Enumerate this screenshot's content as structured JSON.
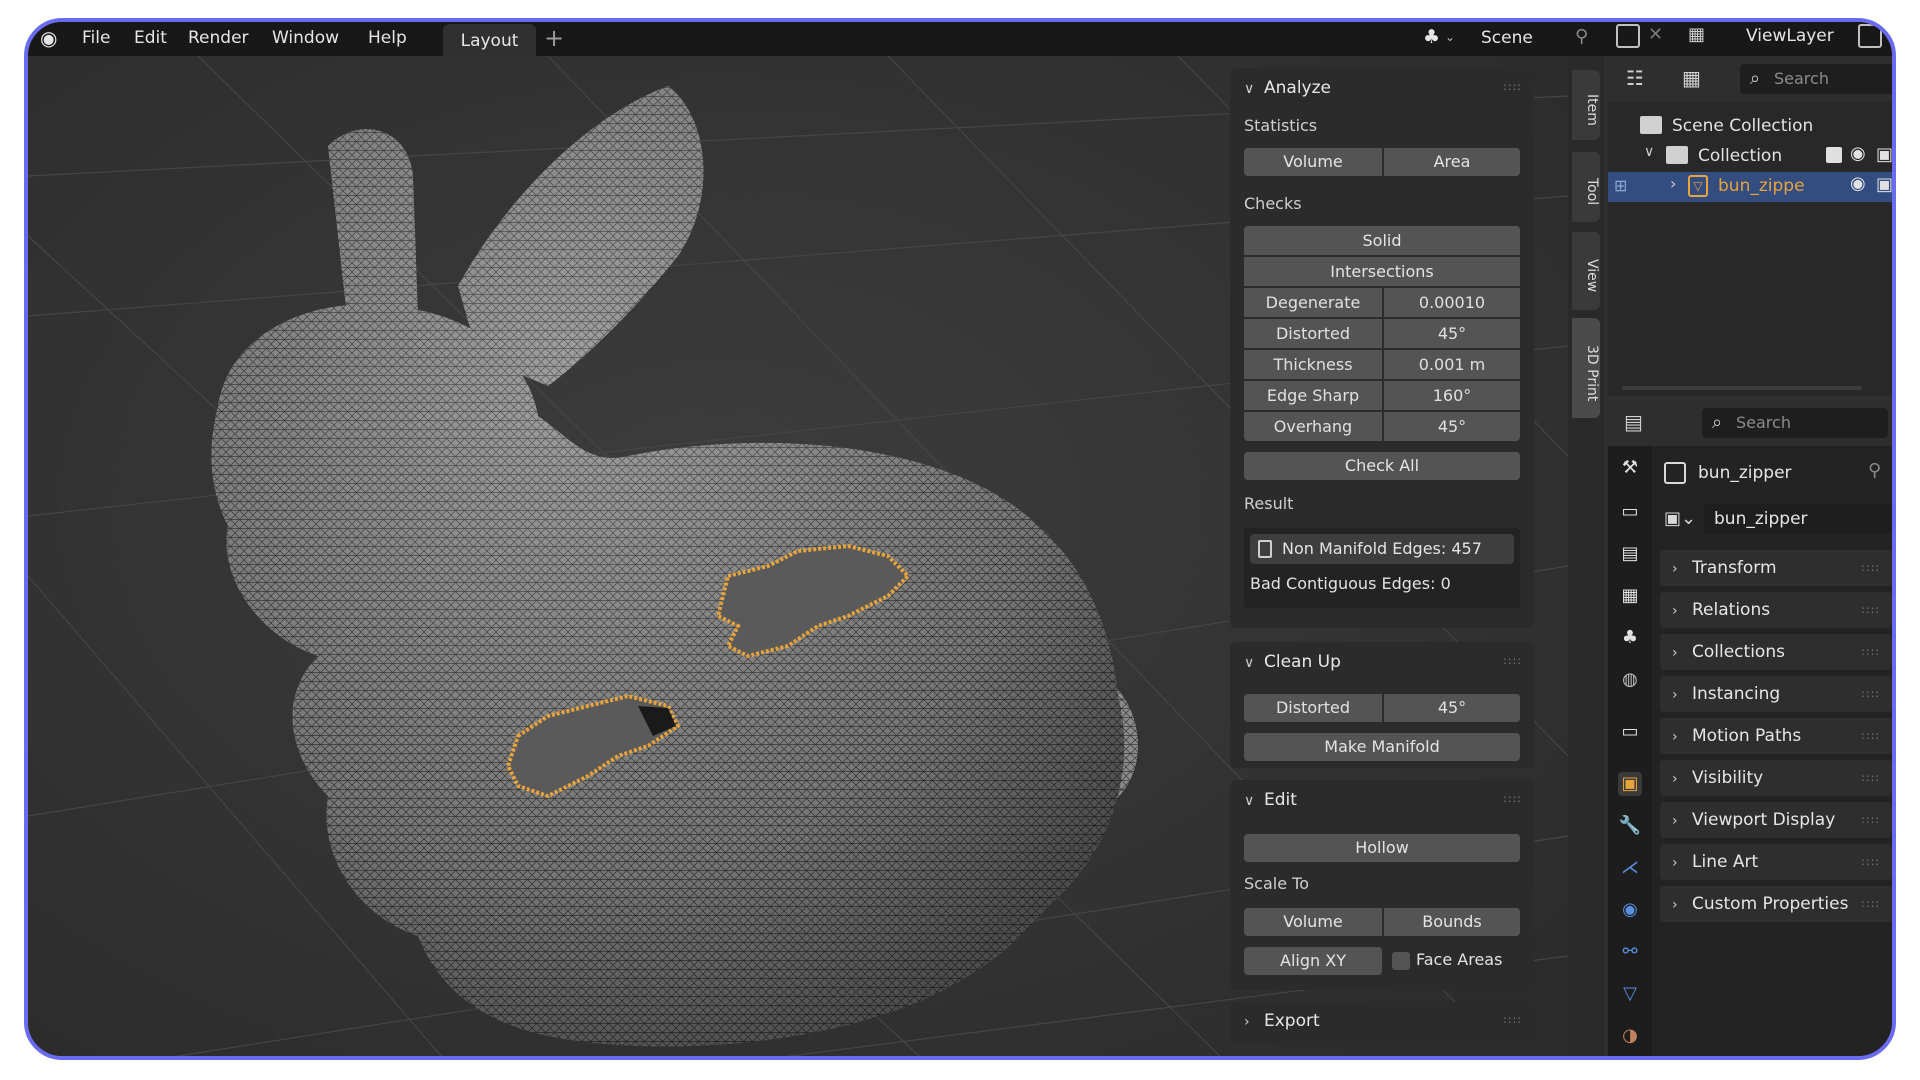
{
  "menu": {
    "items": [
      "File",
      "Edit",
      "Render",
      "Window",
      "Help"
    ],
    "workspace_tab": "Layout",
    "add_tab": "+",
    "scene": "Scene",
    "view_layer": "ViewLayer"
  },
  "sidebar_tabs": [
    "Item",
    "Tool",
    "View",
    "3D Print"
  ],
  "analyze": {
    "title": "Analyze",
    "statistics_label": "Statistics",
    "volume_btn": "Volume",
    "area_btn": "Area",
    "checks_label": "Checks",
    "solid_btn": "Solid",
    "intersections_btn": "Intersections",
    "checks": [
      {
        "label": "Degenerate",
        "value": "0.00010"
      },
      {
        "label": "Distorted",
        "value": "45°"
      },
      {
        "label": "Thickness",
        "value": "0.001 m"
      },
      {
        "label": "Edge Sharp",
        "value": "160°"
      },
      {
        "label": "Overhang",
        "value": "45°"
      }
    ],
    "check_all_btn": "Check All",
    "result_label": "Result",
    "result_primary": "Non Manifold Edges: 457",
    "result_secondary": "Bad Contiguous Edges: 0"
  },
  "cleanup": {
    "title": "Clean Up",
    "distorted_label": "Distorted",
    "distorted_value": "45°",
    "make_manifold_btn": "Make Manifold"
  },
  "edit": {
    "title": "Edit",
    "hollow_btn": "Hollow",
    "scale_to_label": "Scale To",
    "volume_btn": "Volume",
    "bounds_btn": "Bounds",
    "align_btn": "Align XY",
    "face_areas_label": "Face Areas"
  },
  "export": {
    "title": "Export"
  },
  "outliner": {
    "search_placeholder": "Search",
    "scene_collection": "Scene Collection",
    "collection": "Collection",
    "object": "bun_zippe"
  },
  "properties": {
    "search_placeholder": "Search",
    "object_name": "bun_zipper",
    "object_field": "bun_zipper",
    "panels": [
      "Transform",
      "Relations",
      "Collections",
      "Instancing",
      "Motion Paths",
      "Visibility",
      "Viewport Display",
      "Line Art",
      "Custom Properties"
    ]
  },
  "colors": {
    "accent": "#6a6cf0",
    "selection": "#334d80",
    "object_orange": "#e8a33a",
    "panel_bg": "#2b2b2b",
    "button_bg": "#545454"
  }
}
